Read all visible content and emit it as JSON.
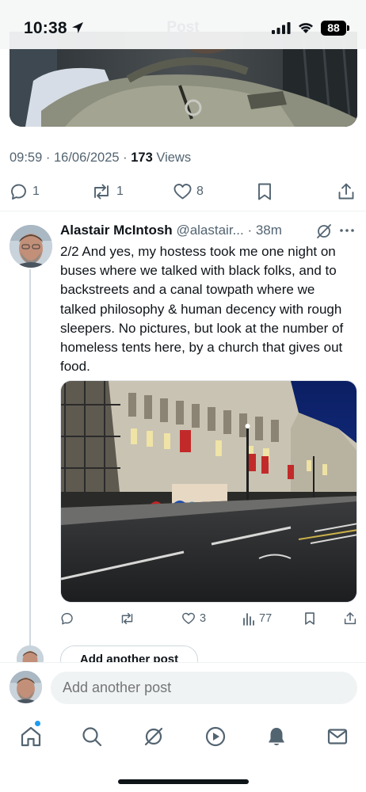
{
  "status_bar": {
    "time": "10:38",
    "screen_title": "Post",
    "battery": "88"
  },
  "main_post": {
    "time": "09:59",
    "date": "16/06/2025",
    "views_count": "173",
    "views_label": "Views",
    "replies": "1",
    "reposts": "1",
    "likes": "8"
  },
  "reply": {
    "author_name": "Alastair McIntosh",
    "handle": "@alastair...",
    "age": "38m",
    "text": "2/2 And yes, my hostess took me one night on buses where we talked with black folks, and to backstreets and a canal towpath where we talked philosophy & human decency with rough sleepers. No pictures, but look at the number of homeless tents here, by a church that gives out food.",
    "likes": "3",
    "views": "77"
  },
  "thread_add_label": "Add another post",
  "composer": {
    "placeholder": "Add another post"
  },
  "nav": {
    "items": [
      "home-icon",
      "search-icon",
      "grok-icon",
      "video-icon",
      "notifications-icon",
      "messages-icon"
    ]
  },
  "colors": {
    "text_primary": "#0f1419",
    "text_secondary": "#536471",
    "accent": "#1d9bf0",
    "divider": "#eff3f4"
  }
}
